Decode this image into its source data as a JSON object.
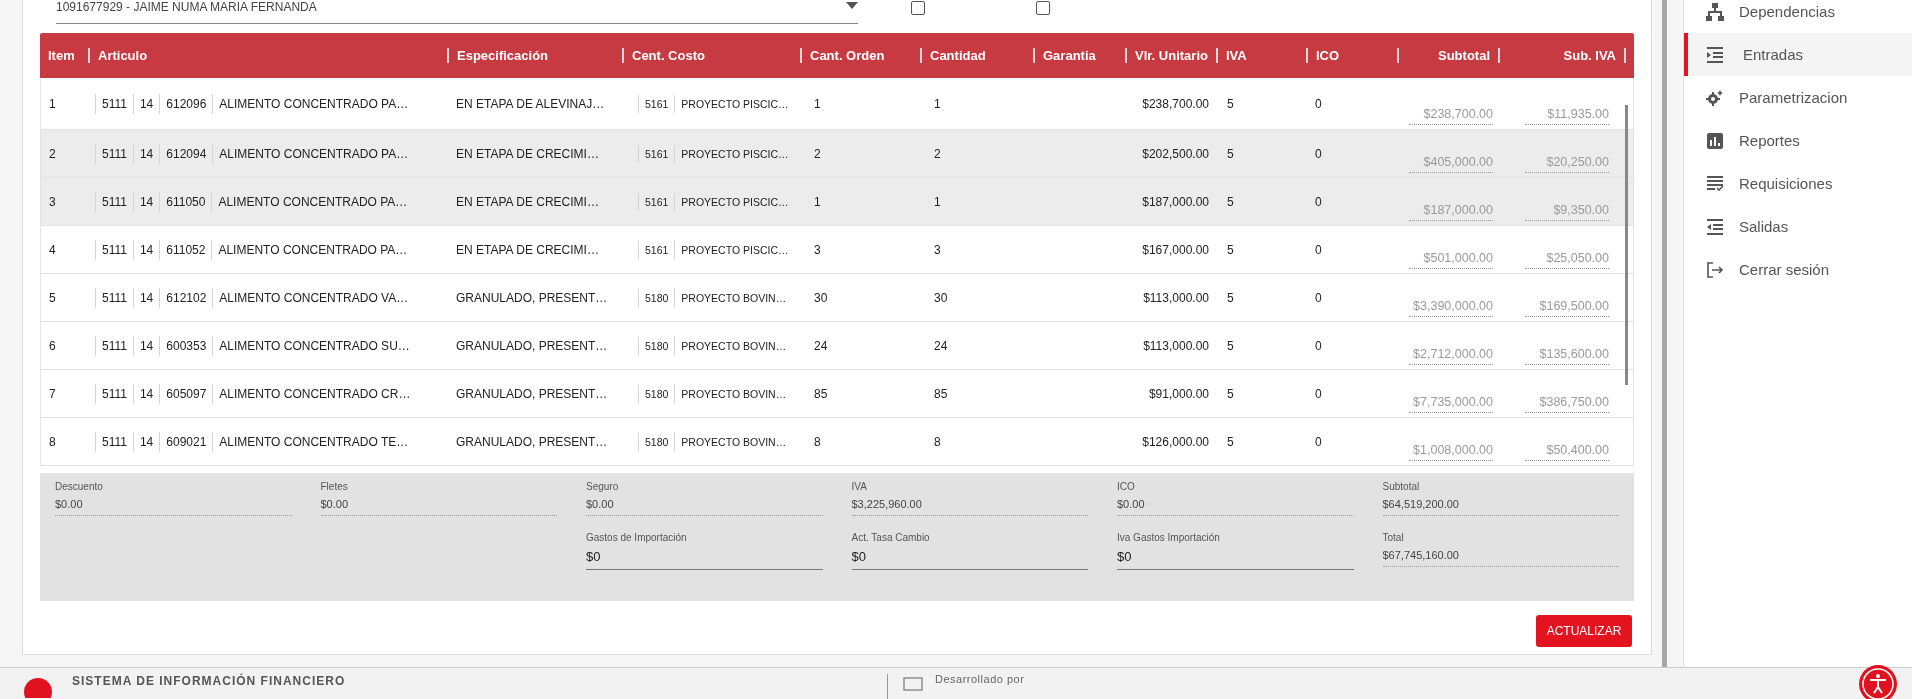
{
  "supplier_select": {
    "value": "1091677929 - JAIME NUMA MARIA FERNANDA"
  },
  "checkboxes": [
    {
      "checked": false
    },
    {
      "checked": false
    }
  ],
  "table": {
    "columns": [
      "Item",
      "Articulo",
      "Especificación",
      "Cent. Costo",
      "Cant. Orden",
      "Cantidad",
      "Garantia",
      "Vlr. Unitario",
      "IVA",
      "ICO",
      "Subtotal",
      "Sub. IVA"
    ],
    "rows": [
      {
        "item": "1",
        "article": {
          "group": "5111",
          "subgroup": "14",
          "code": "612096",
          "name": "ALIMENTO CONCENTRADO PA…"
        },
        "specification": "EN ETAPA DE ALEVINAJ…",
        "cost_center": {
          "code": "5161",
          "name": "PROYECTO PISCIC…"
        },
        "ordered_qty": "1",
        "quantity": "1",
        "unit_value": "$238,700.00",
        "iva": "5",
        "ico": "0",
        "subtotal": "$238,700.00",
        "sub_iva": "$11,935.00",
        "highlighted": false
      },
      {
        "item": "2",
        "article": {
          "group": "5111",
          "subgroup": "14",
          "code": "612094",
          "name": "ALIMENTO CONCENTRADO PA…"
        },
        "specification": "EN ETAPA DE CRECIMI…",
        "cost_center": {
          "code": "5161",
          "name": "PROYECTO PISCIC…"
        },
        "ordered_qty": "2",
        "quantity": "2",
        "unit_value": "$202,500.00",
        "iva": "5",
        "ico": "0",
        "subtotal": "$405,000.00",
        "sub_iva": "$20,250.00",
        "highlighted": true
      },
      {
        "item": "3",
        "article": {
          "group": "5111",
          "subgroup": "14",
          "code": "611050",
          "name": "ALIMENTO CONCENTRADO PA…"
        },
        "specification": "EN ETAPA DE CRECIMI…",
        "cost_center": {
          "code": "5161",
          "name": "PROYECTO PISCIC…"
        },
        "ordered_qty": "1",
        "quantity": "1",
        "unit_value": "$187,000.00",
        "iva": "5",
        "ico": "0",
        "subtotal": "$187,000.00",
        "sub_iva": "$9,350.00",
        "highlighted": true
      },
      {
        "item": "4",
        "article": {
          "group": "5111",
          "subgroup": "14",
          "code": "611052",
          "name": "ALIMENTO CONCENTRADO PA…"
        },
        "specification": "EN ETAPA DE CRECIMI…",
        "cost_center": {
          "code": "5161",
          "name": "PROYECTO PISCIC…"
        },
        "ordered_qty": "3",
        "quantity": "3",
        "unit_value": "$167,000.00",
        "iva": "5",
        "ico": "0",
        "subtotal": "$501,000.00",
        "sub_iva": "$25,050.00",
        "highlighted": false
      },
      {
        "item": "5",
        "article": {
          "group": "5111",
          "subgroup": "14",
          "code": "612102",
          "name": "ALIMENTO CONCENTRADO VA…"
        },
        "specification": "GRANULADO, PRESENT…",
        "cost_center": {
          "code": "5180",
          "name": "PROYECTO BOVIN…"
        },
        "ordered_qty": "30",
        "quantity": "30",
        "unit_value": "$113,000.00",
        "iva": "5",
        "ico": "0",
        "subtotal": "$3,390,000.00",
        "sub_iva": "$169,500.00",
        "highlighted": false
      },
      {
        "item": "6",
        "article": {
          "group": "5111",
          "subgroup": "14",
          "code": "600353",
          "name": "ALIMENTO CONCENTRADO SU…"
        },
        "specification": "GRANULADO, PRESENT…",
        "cost_center": {
          "code": "5180",
          "name": "PROYECTO BOVIN…"
        },
        "ordered_qty": "24",
        "quantity": "24",
        "unit_value": "$113,000.00",
        "iva": "5",
        "ico": "0",
        "subtotal": "$2,712,000.00",
        "sub_iva": "$135,600.00",
        "highlighted": false
      },
      {
        "item": "7",
        "article": {
          "group": "5111",
          "subgroup": "14",
          "code": "605097",
          "name": "ALIMENTO CONCENTRADO CR…"
        },
        "specification": "GRANULADO, PRESENT…",
        "cost_center": {
          "code": "5180",
          "name": "PROYECTO BOVIN…"
        },
        "ordered_qty": "85",
        "quantity": "85",
        "unit_value": "$91,000.00",
        "iva": "5",
        "ico": "0",
        "subtotal": "$7,735,000.00",
        "sub_iva": "$386,750.00",
        "highlighted": false
      },
      {
        "item": "8",
        "article": {
          "group": "5111",
          "subgroup": "14",
          "code": "609021",
          "name": "ALIMENTO CONCENTRADO TE…"
        },
        "specification": "GRANULADO, PRESENT…",
        "cost_center": {
          "code": "5180",
          "name": "PROYECTO BOVIN…"
        },
        "ordered_qty": "8",
        "quantity": "8",
        "unit_value": "$126,000.00",
        "iva": "5",
        "ico": "0",
        "subtotal": "$1,008,000.00",
        "sub_iva": "$50,400.00",
        "highlighted": false
      }
    ]
  },
  "totals": {
    "rows": [
      [
        {
          "label": "Descuento",
          "value": "$0.00",
          "kind": "readonly"
        },
        {
          "label": "Fletes",
          "value": "$0.00",
          "kind": "readonly"
        },
        {
          "label": "Seguro",
          "value": "$0.00",
          "kind": "readonly"
        },
        {
          "label": "IVA",
          "value": "$3,225,960.00",
          "kind": "readonly"
        },
        {
          "label": "ICO",
          "value": "$0.00",
          "kind": "readonly"
        },
        {
          "label": "Subtotal",
          "value": "$64,519,200.00",
          "kind": "readonly"
        }
      ],
      [
        "",
        "",
        {
          "label": "Gastos de Importación",
          "value": "$0",
          "kind": "input"
        },
        {
          "label": "Act. Tasa Cambio",
          "value": "$0",
          "kind": "input"
        },
        {
          "label": "Iva Gastos Importación",
          "value": "$0",
          "kind": "input"
        },
        {
          "label": "Total",
          "value": "$67,745,160.00",
          "kind": "readonly"
        }
      ]
    ]
  },
  "update_button": "ACTUALIZAR",
  "sidebar": {
    "items": [
      {
        "label": "Dependencias",
        "selected": false
      },
      {
        "label": "Entradas",
        "selected": true
      },
      {
        "label": "Parametrizacion",
        "selected": false
      },
      {
        "label": "Reportes",
        "selected": false
      },
      {
        "label": "Requisiciones",
        "selected": false
      },
      {
        "label": "Salidas",
        "selected": false
      },
      {
        "label": "Cerrar sesión",
        "selected": false
      }
    ]
  },
  "footer": {
    "title": "SISTEMA DE INFORMACIÓN FINANCIERO",
    "credit": "Desarrollado por"
  }
}
